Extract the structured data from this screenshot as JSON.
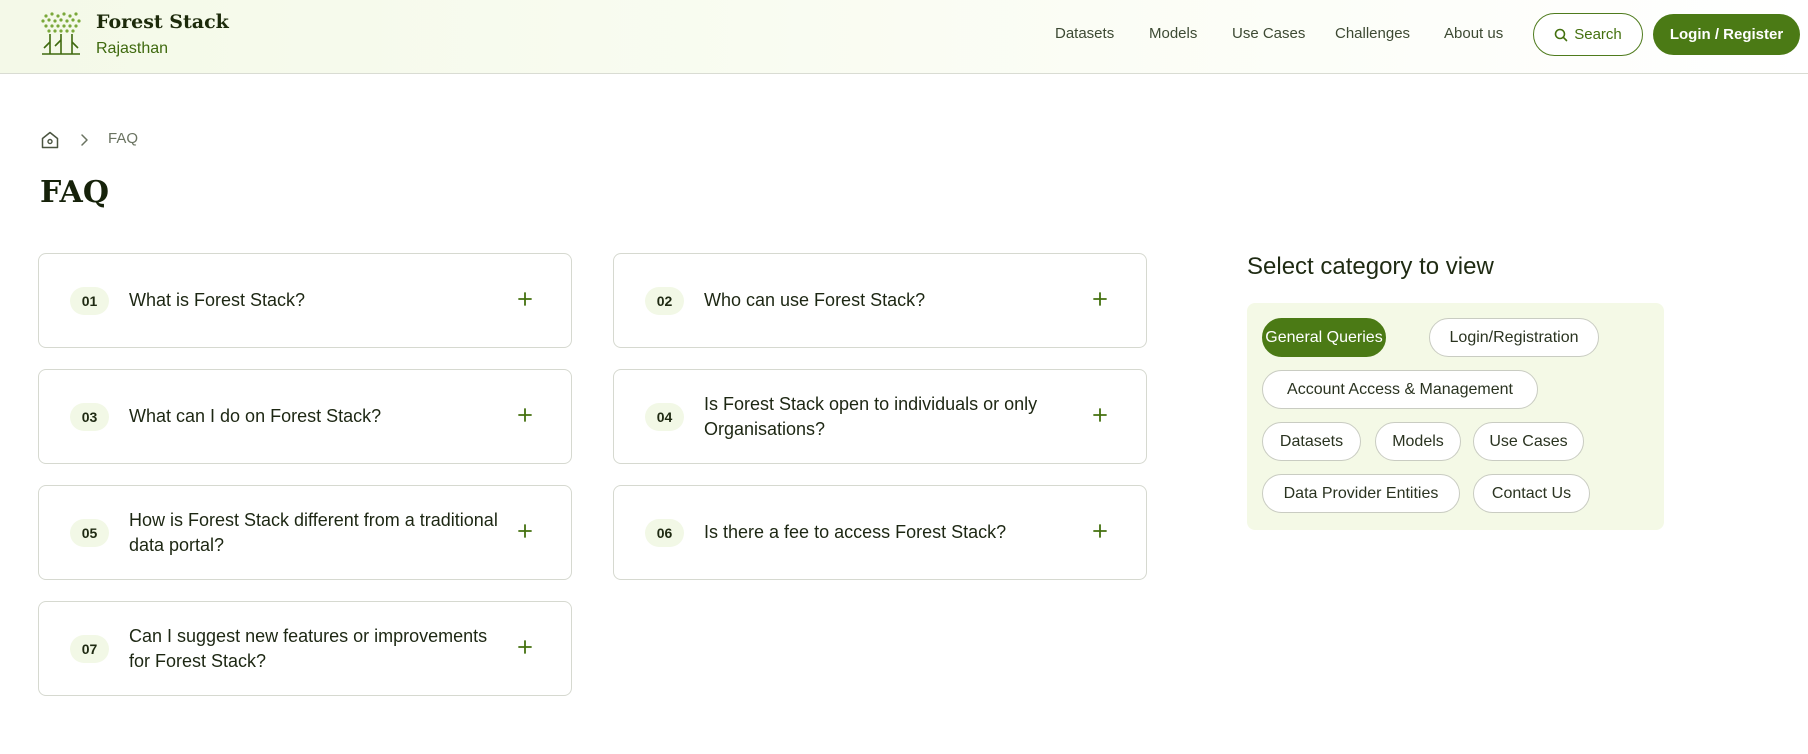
{
  "brand": {
    "name": "Forest Stack",
    "subtitle": "Rajasthan"
  },
  "nav": [
    "Datasets",
    "Models",
    "Use Cases",
    "Challenges",
    "About us"
  ],
  "header": {
    "search_label": "Search",
    "login_label": "Login / Register"
  },
  "breadcrumb": {
    "current": "FAQ"
  },
  "page": {
    "title": "FAQ"
  },
  "faqs": [
    {
      "num": "01",
      "q": "What is Forest Stack?"
    },
    {
      "num": "02",
      "q": "Who can use Forest Stack?"
    },
    {
      "num": "03",
      "q": "What can I do on Forest Stack?"
    },
    {
      "num": "04",
      "q": "Is Forest Stack open to individuals or only Organisations?"
    },
    {
      "num": "05",
      "q": "How is Forest Stack different from a traditional data portal?"
    },
    {
      "num": "06",
      "q": "Is there a fee to access Forest Stack?"
    },
    {
      "num": "07",
      "q": "Can I suggest new features or improvements for Forest Stack?"
    }
  ],
  "categories": {
    "title": "Select category to view",
    "items": [
      "General Queries",
      "Login/Registration",
      "Account Access & Management",
      "Datasets",
      "Models",
      "Use Cases",
      "Data Provider Entities",
      "Contact Us"
    ],
    "selected": "General Queries"
  },
  "colors": {
    "primary": "#4b7a15",
    "panel": "#f4f9e6",
    "border": "#d6d9d0"
  }
}
